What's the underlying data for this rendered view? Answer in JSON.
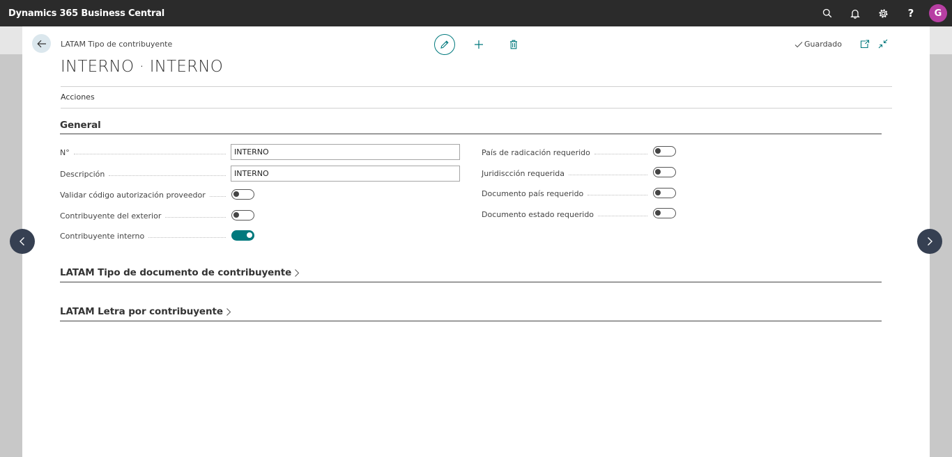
{
  "app": {
    "title": "Dynamics 365 Business Central",
    "avatar_initial": "G",
    "help_glyph": "?"
  },
  "page": {
    "breadcrumb": "LATAM Tipo de contribuyente",
    "title": "INTERNO · INTERNO",
    "saved_status": "Guardado",
    "actions_label": "Acciones"
  },
  "general": {
    "title": "General",
    "left_fields": [
      {
        "label": "N°",
        "value": "INTERNO"
      },
      {
        "label": "Descripción",
        "value": "INTERNO"
      },
      {
        "label": "Validar código autorización proveedor",
        "toggle": false
      },
      {
        "label": "Contribuyente del exterior",
        "toggle": false
      },
      {
        "label": "Contribuyente interno",
        "toggle": true
      }
    ],
    "right_fields": [
      {
        "label": "País de radicación requerido",
        "toggle": false
      },
      {
        "label": "Juridiscción requerida",
        "toggle": false
      },
      {
        "label": "Documento país requerido",
        "toggle": false
      },
      {
        "label": "Documento estado requerido",
        "toggle": false
      }
    ]
  },
  "sections": [
    {
      "title": "LATAM Tipo de documento de contribuyente"
    },
    {
      "title": "LATAM Letra por contribuyente"
    }
  ],
  "colors": {
    "accent": "#00797d",
    "topbar": "#2b2b2b",
    "avatar": "#b73fa3",
    "nav_button": "#364052"
  }
}
